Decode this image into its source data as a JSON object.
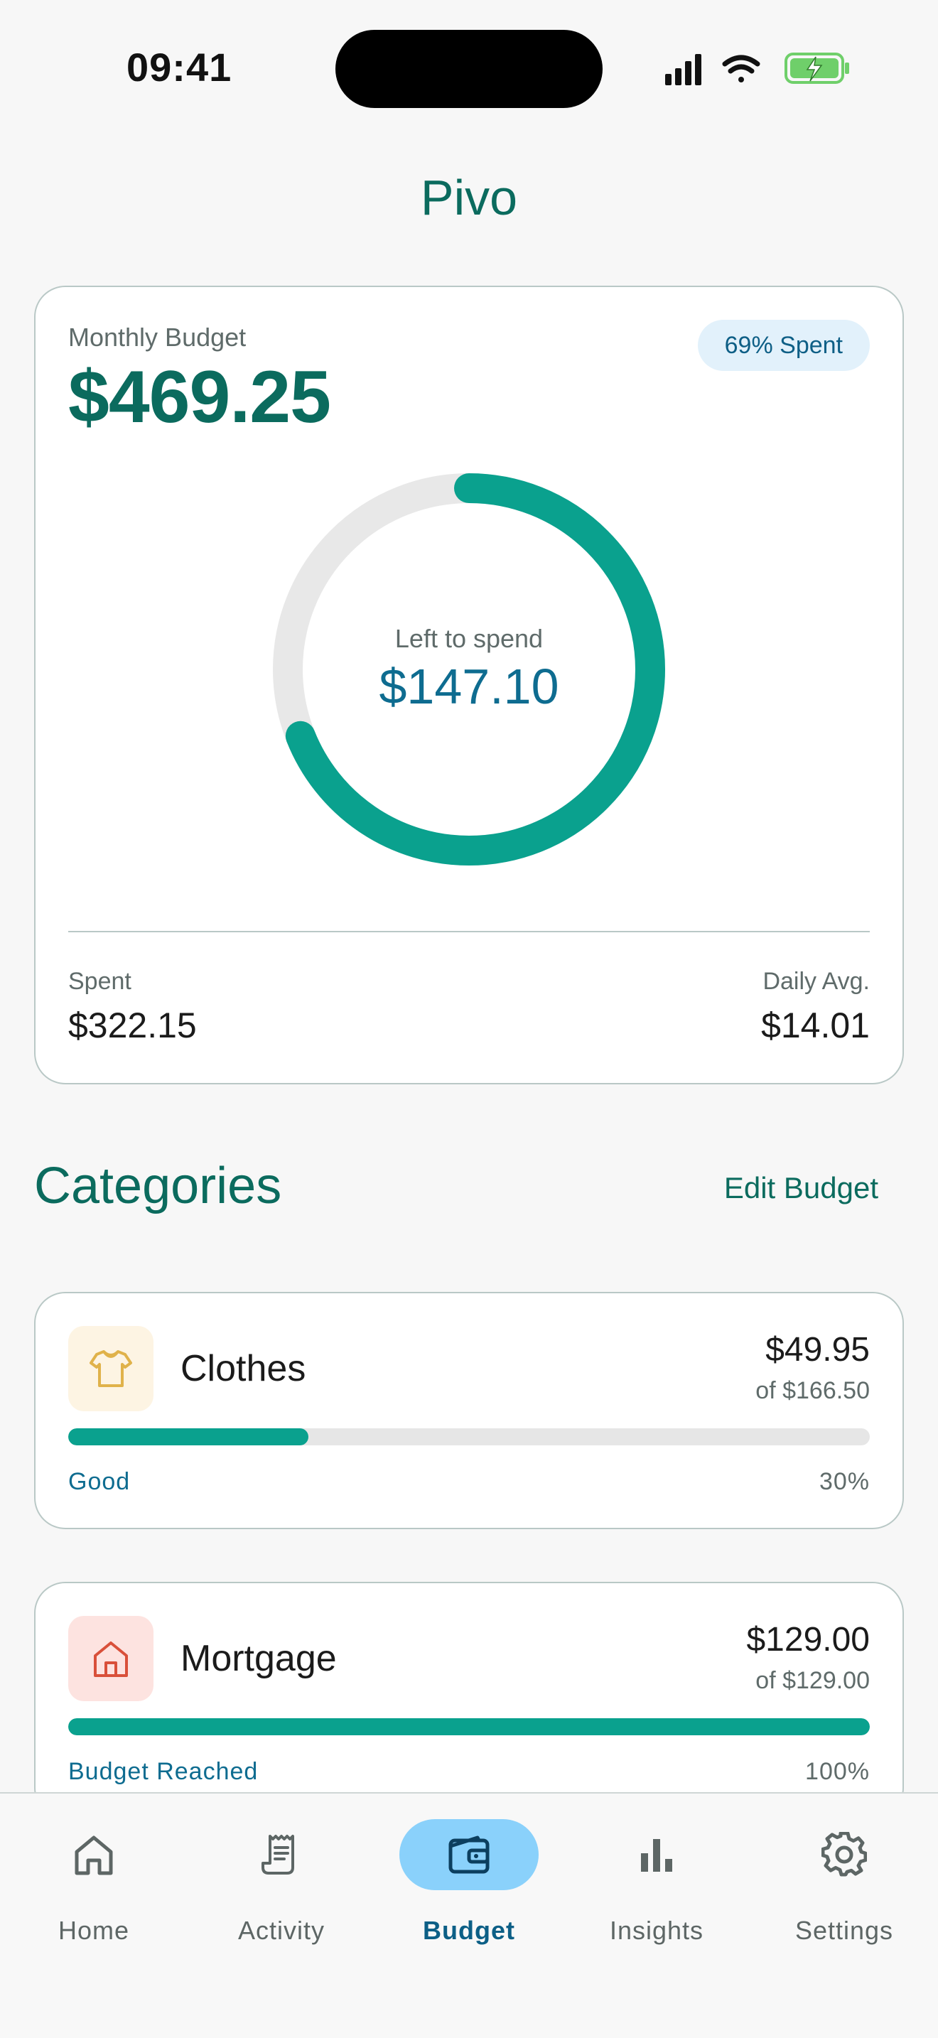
{
  "status_bar": {
    "time": "09:41"
  },
  "header": {
    "title": "Pivo"
  },
  "budget": {
    "label": "Monthly Budget",
    "amount": "$469.25",
    "badge": "69% Spent",
    "spent_fraction": 0.69,
    "left_label": "Left to spend",
    "left_amount": "$147.10",
    "spent_label": "Spent",
    "spent_amount": "$322.15",
    "daily_label": "Daily Avg.",
    "daily_amount": "$14.01",
    "ring_color": "#0aa18e",
    "track_color": "#e8e8e8"
  },
  "categories": {
    "title": "Categories",
    "edit_label": "Edit Budget",
    "items": [
      {
        "name": "Clothes",
        "amount": "$49.95",
        "limit": "of $166.50",
        "status": "Good",
        "percent": "30%",
        "progress": 0.3,
        "icon": "shirt-icon",
        "icon_bg": "#fdf4e3",
        "icon_color": "#e0b24a"
      },
      {
        "name": "Mortgage",
        "amount": "$129.00",
        "limit": "of $129.00",
        "status": "Budget Reached",
        "percent": "100%",
        "progress": 1.0,
        "icon": "house-icon",
        "icon_bg": "#fde3e0",
        "icon_color": "#d9503a"
      }
    ]
  },
  "nav": {
    "items": [
      {
        "label": "Home",
        "icon": "home-icon",
        "active": false
      },
      {
        "label": "Activity",
        "icon": "receipt-icon",
        "active": false
      },
      {
        "label": "Budget",
        "icon": "wallet-icon",
        "active": true
      },
      {
        "label": "Insights",
        "icon": "bar-chart-icon",
        "active": false
      },
      {
        "label": "Settings",
        "icon": "gear-icon",
        "active": false
      }
    ]
  }
}
